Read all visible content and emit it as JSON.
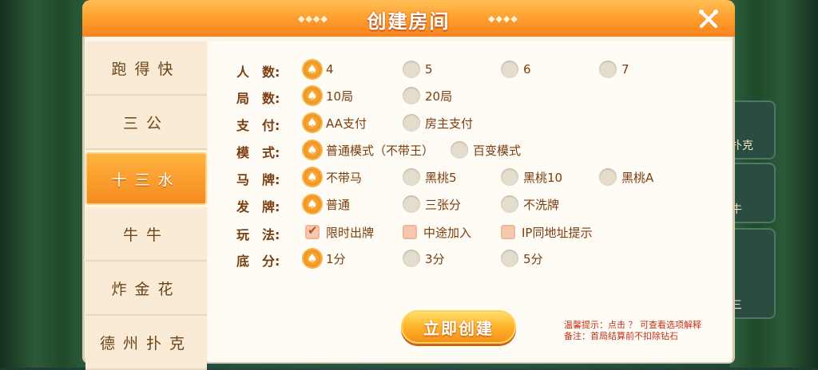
{
  "title": "创建房间",
  "header_deco": "◆◆◆◆",
  "games": [
    "跑得快",
    "三公",
    "十三水",
    "牛牛",
    "炸金花",
    "德州扑克"
  ],
  "active_game": "十三水",
  "side_cards": [
    "扑克",
    "牛",
    "三"
  ],
  "rows": [
    {
      "label": "人　数:",
      "type": "radio",
      "options": [
        "4",
        "5",
        "6",
        "7"
      ],
      "selected": "4"
    },
    {
      "label": "局　数:",
      "type": "radio",
      "options": [
        "10局",
        "20局"
      ],
      "selected": "10局"
    },
    {
      "label": "支　付:",
      "type": "radio",
      "options": [
        "AA支付",
        "房主支付"
      ],
      "selected": "AA支付"
    },
    {
      "label": "模　式:",
      "type": "radio",
      "options": [
        "普通模式（不带王）",
        "百变模式"
      ],
      "selected": "普通模式（不带王）"
    },
    {
      "label": "马　牌:",
      "type": "radio",
      "options": [
        "不带马",
        "黑桃5",
        "黑桃10",
        "黑桃A"
      ],
      "selected": "不带马"
    },
    {
      "label": "发　牌:",
      "type": "radio",
      "options": [
        "普通",
        "三张分",
        "不洗牌"
      ],
      "selected": "普通"
    },
    {
      "label": "玩　法:",
      "type": "checkbox",
      "options": [
        "限时出牌",
        "中途加入",
        "IP同地址提示"
      ],
      "checked": [
        "限时出牌"
      ]
    },
    {
      "label": "底　分:",
      "type": "radio",
      "options": [
        "1分",
        "3分",
        "5分"
      ],
      "selected": "1分"
    }
  ],
  "create_button": "立即创建",
  "tips": {
    "line1": "温馨提示：点击 ？ 可查看选项解释",
    "line2": "备注：首局结算前不扣除钻石"
  },
  "colors": {
    "accent": "#f59a24",
    "label": "#7a3d0f",
    "tip": "#c0321c",
    "header": "#ff9e2e"
  }
}
